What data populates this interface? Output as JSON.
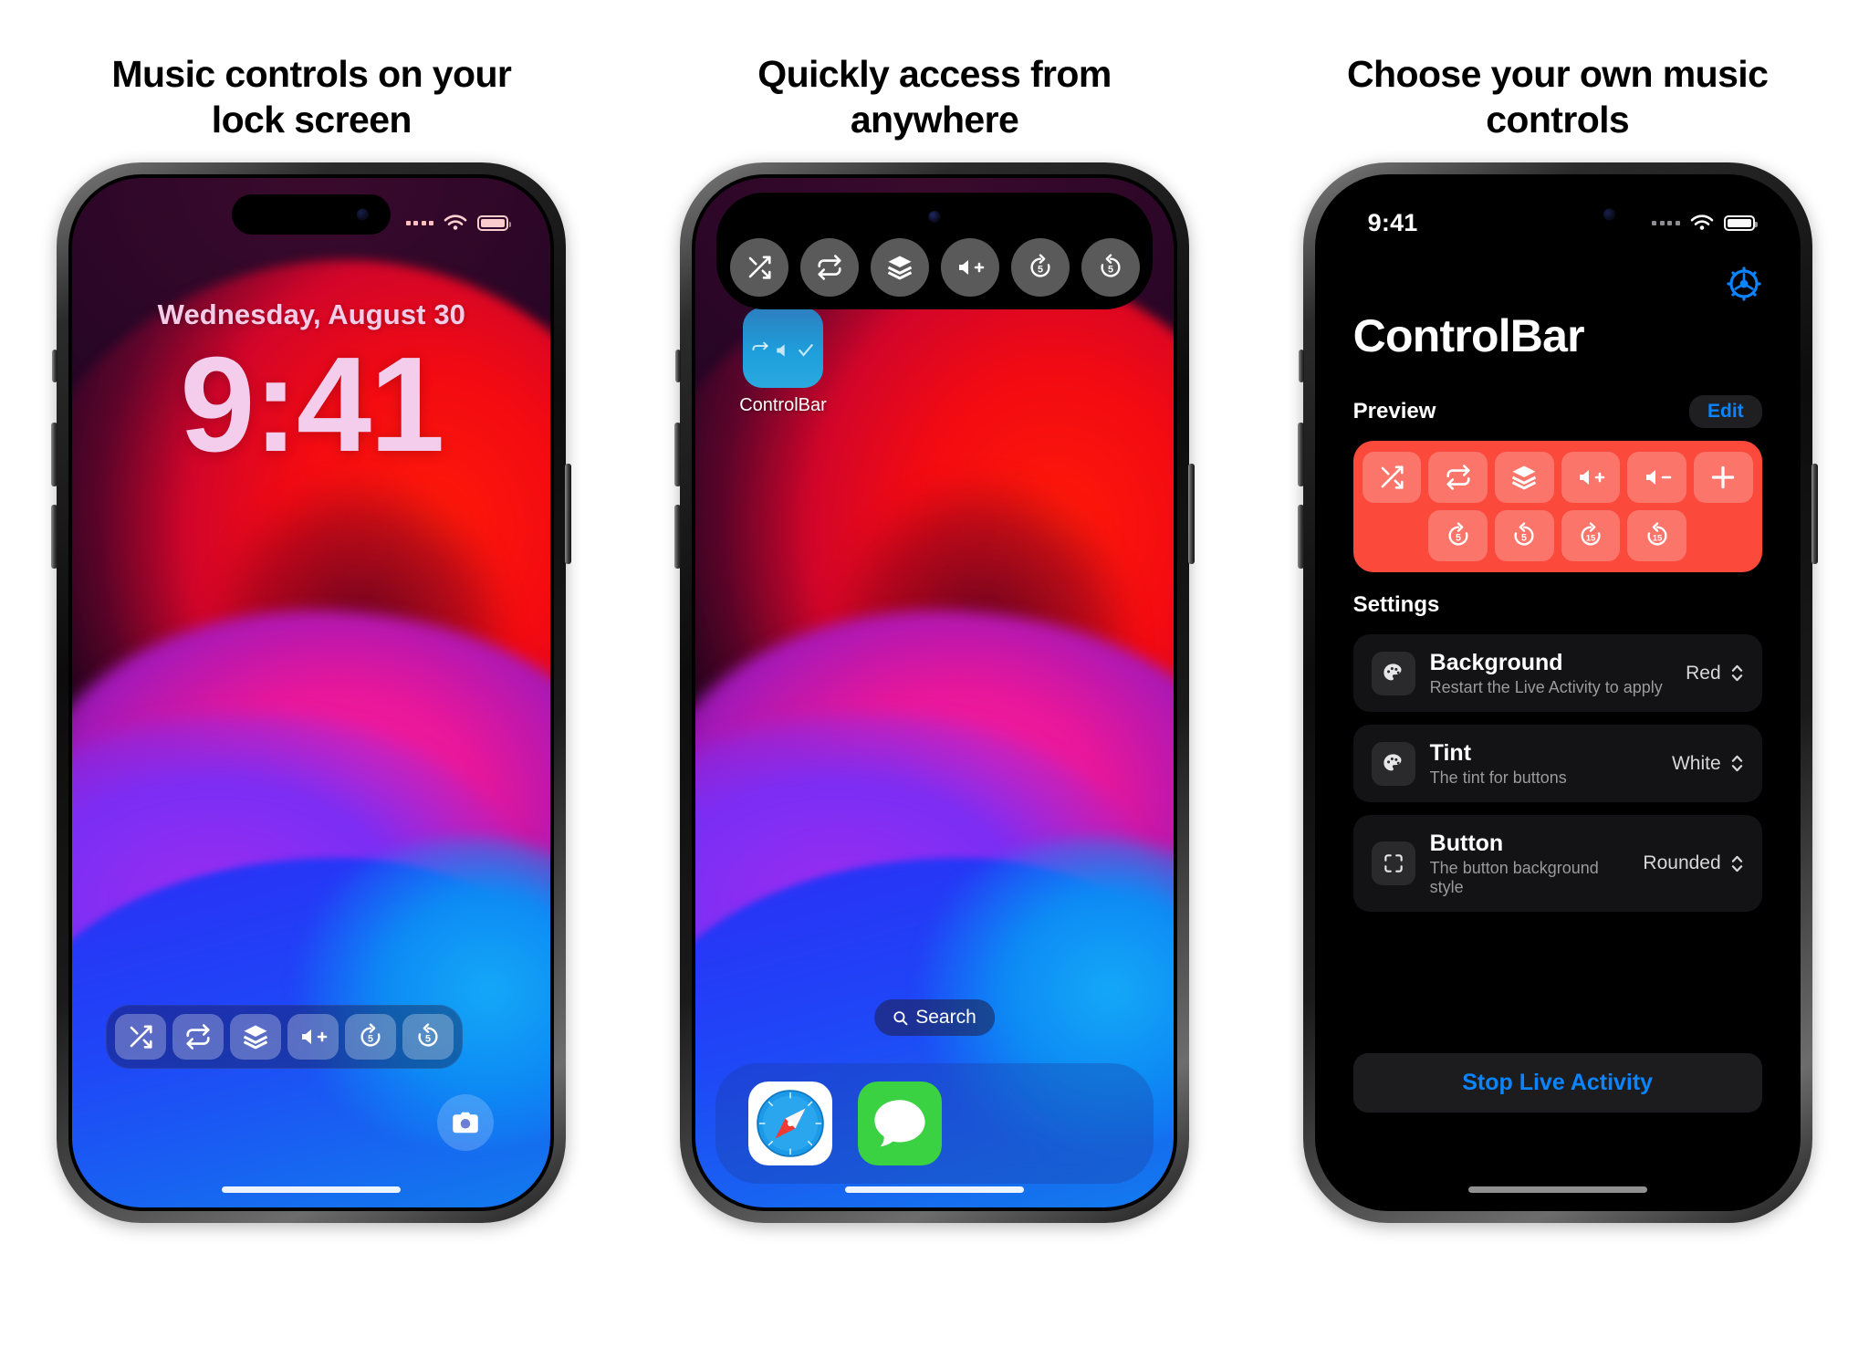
{
  "headings": [
    "Music controls on your lock screen",
    "Quickly access from anywhere",
    "Choose your own music controls"
  ],
  "colors": {
    "accent_blue": "#0a84ff",
    "preview_red": "#fb4a3c",
    "lock_time_pink": "#f4ccec",
    "row_bg": "#131315"
  },
  "phone1": {
    "status_bar": {
      "dots": "signal-dots",
      "wifi": "wifi-icon",
      "battery": "battery-icon"
    },
    "lock": {
      "date": "Wednesday, August 30",
      "time": "9:41"
    },
    "control_bar": [
      {
        "icon": "shuffle-icon",
        "label": "Shuffle"
      },
      {
        "icon": "repeat-icon",
        "label": "Repeat"
      },
      {
        "icon": "layers-icon",
        "label": "Queue"
      },
      {
        "icon": "volume-up-icon",
        "label": "Volume Up"
      },
      {
        "icon": "forward-5-icon",
        "label": "5"
      },
      {
        "icon": "backward-5-icon",
        "label": "5"
      }
    ],
    "camera_button": "camera-icon"
  },
  "phone2": {
    "dynamic_island": [
      {
        "icon": "shuffle-icon",
        "label": "Shuffle"
      },
      {
        "icon": "repeat-icon",
        "label": "Repeat"
      },
      {
        "icon": "layers-icon",
        "label": "Queue"
      },
      {
        "icon": "volume-up-icon",
        "label": "Volume Up"
      },
      {
        "icon": "forward-5-icon",
        "label": "5"
      },
      {
        "icon": "backward-5-icon",
        "label": "5"
      }
    ],
    "app_icon_label": "ControlBar",
    "search_label": "Search",
    "dock": [
      {
        "icon": "safari-icon",
        "label": "Safari"
      },
      {
        "icon": "messages-icon",
        "label": "Messages"
      }
    ]
  },
  "phone3": {
    "status_bar": {
      "time": "9:41",
      "dots": "signal-dots",
      "wifi": "wifi-icon",
      "battery": "battery-icon"
    },
    "gear_icon": "gear-icon",
    "title": "ControlBar",
    "preview": {
      "header": "Preview",
      "edit_label": "Edit",
      "row1": [
        {
          "icon": "shuffle-icon",
          "label": ""
        },
        {
          "icon": "repeat-icon",
          "label": ""
        },
        {
          "icon": "layers-icon",
          "label": ""
        },
        {
          "icon": "volume-up-icon",
          "label": ""
        },
        {
          "icon": "volume-down-icon",
          "label": ""
        },
        {
          "icon": "plus-icon",
          "label": ""
        }
      ],
      "row2": [
        {
          "icon": "forward-5-icon",
          "label": "5"
        },
        {
          "icon": "backward-5-icon",
          "label": "5"
        },
        {
          "icon": "forward-15-icon",
          "label": "15"
        },
        {
          "icon": "backward-15-icon",
          "label": "15"
        }
      ]
    },
    "settings": {
      "header": "Settings",
      "rows": [
        {
          "icon": "palette-icon",
          "title": "Background",
          "subtitle": "Restart the Live Activity to apply",
          "value": "Red"
        },
        {
          "icon": "palette-icon",
          "title": "Tint",
          "subtitle": "The tint for buttons",
          "value": "White"
        },
        {
          "icon": "frame-icon",
          "title": "Button",
          "subtitle": "The button background style",
          "value": "Rounded"
        }
      ]
    },
    "stop_button": "Stop Live Activity"
  }
}
